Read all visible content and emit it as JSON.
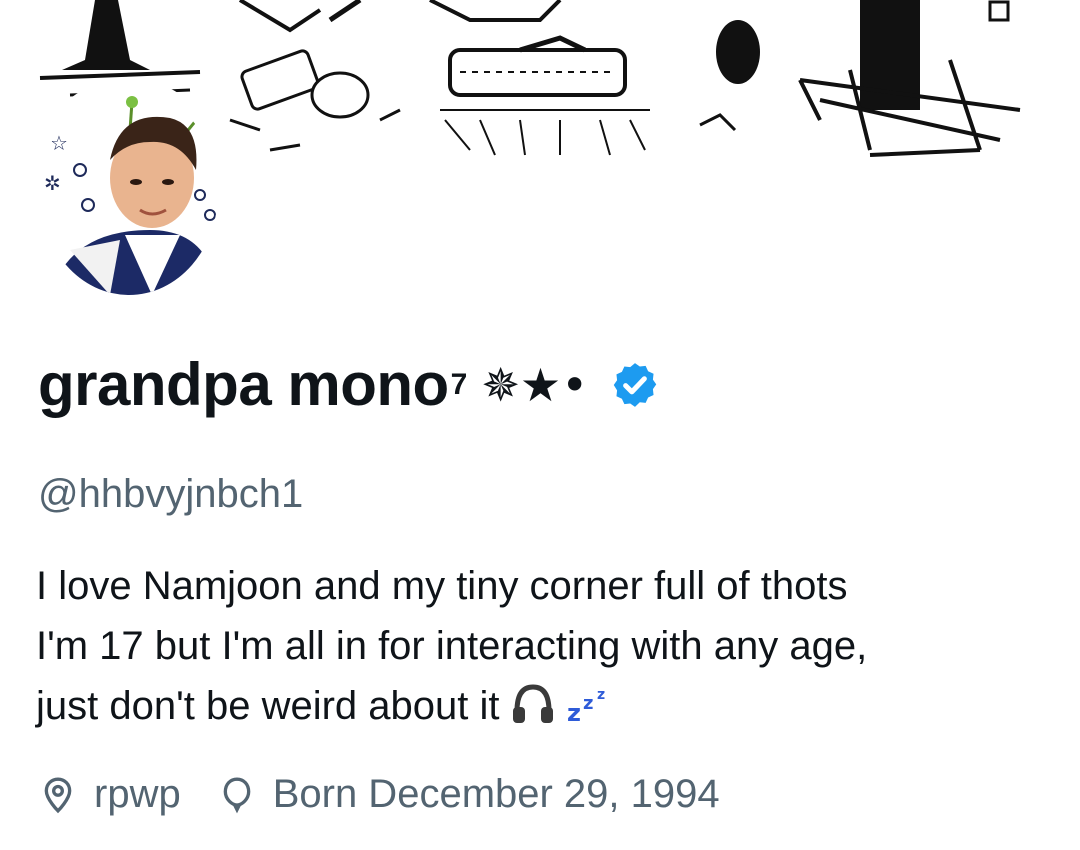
{
  "profile": {
    "display_name": "grandpa mono",
    "name_superscript": "7",
    "name_decoration": "✵★•",
    "verified_color": "#1d9bf0",
    "handle": "@hhbvyjnbch1",
    "bio_lines": [
      "I love Namjoon and my tiny corner full of thots",
      "I'm 17 but I'm all in for interacting with any age,",
      "just don't be weird about it"
    ],
    "bio_emojis": [
      "headphone-emoji",
      "zzz-emoji"
    ],
    "location": "rpwp",
    "birthday": "Born December 29, 1994"
  },
  "colors": {
    "primary_text": "#0f1419",
    "secondary_text": "#536471",
    "accent": "#1d9bf0"
  }
}
